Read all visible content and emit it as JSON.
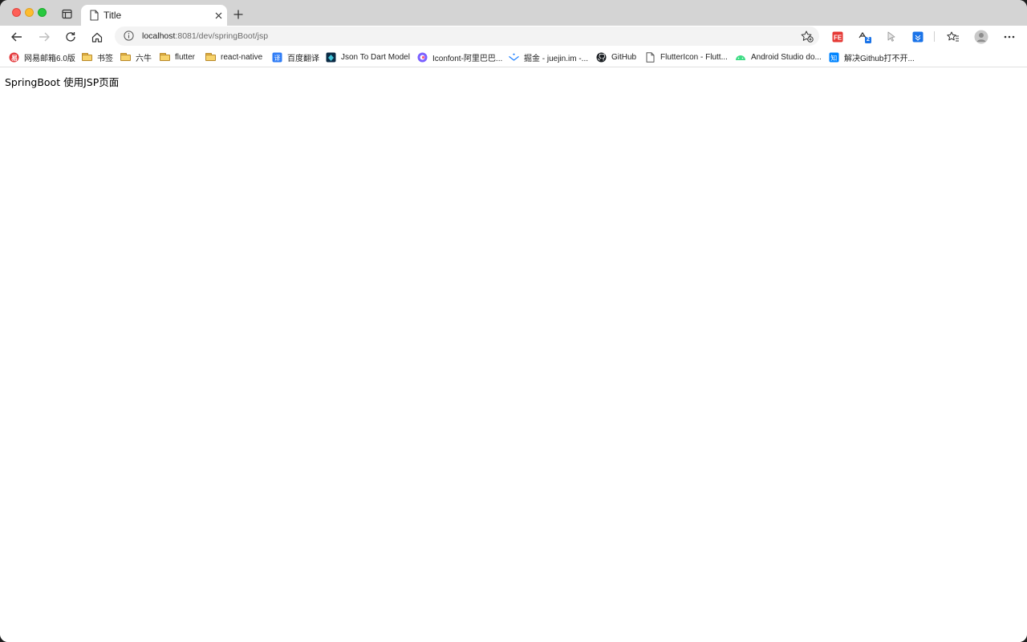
{
  "tab": {
    "title": "Title"
  },
  "address_bar": {
    "host": "localhost",
    "path": ":8081/dev/springBoot/jsp"
  },
  "bookmarks": [
    {
      "label": "网易邮箱6.0版",
      "icon": "netease-mail-icon"
    },
    {
      "label": "书签",
      "icon": "folder-icon"
    },
    {
      "label": "六牛",
      "icon": "folder-icon"
    },
    {
      "label": "flutter",
      "icon": "folder-icon"
    },
    {
      "label": "react-native",
      "icon": "folder-icon"
    },
    {
      "label": "百度翻译",
      "icon": "baidu-translate-icon"
    },
    {
      "label": "Json To Dart Model",
      "icon": "json-dart-icon"
    },
    {
      "label": "Iconfont-阿里巴巴...",
      "icon": "iconfont-icon"
    },
    {
      "label": "掘金 - juejin.im -...",
      "icon": "juejin-icon"
    },
    {
      "label": "GitHub",
      "icon": "github-icon"
    },
    {
      "label": "FlutterIcon - Flutt...",
      "icon": "page-icon"
    },
    {
      "label": "Android Studio do...",
      "icon": "android-icon"
    },
    {
      "label": "解决Github打不开...",
      "icon": "zhihu-icon"
    }
  ],
  "extensions": {
    "badge_count": "2"
  },
  "page": {
    "text": "SpringBoot 使用JSP页面"
  },
  "colors": {
    "tabstrip": "#d4d4d4",
    "accent": "#1a73e8"
  }
}
